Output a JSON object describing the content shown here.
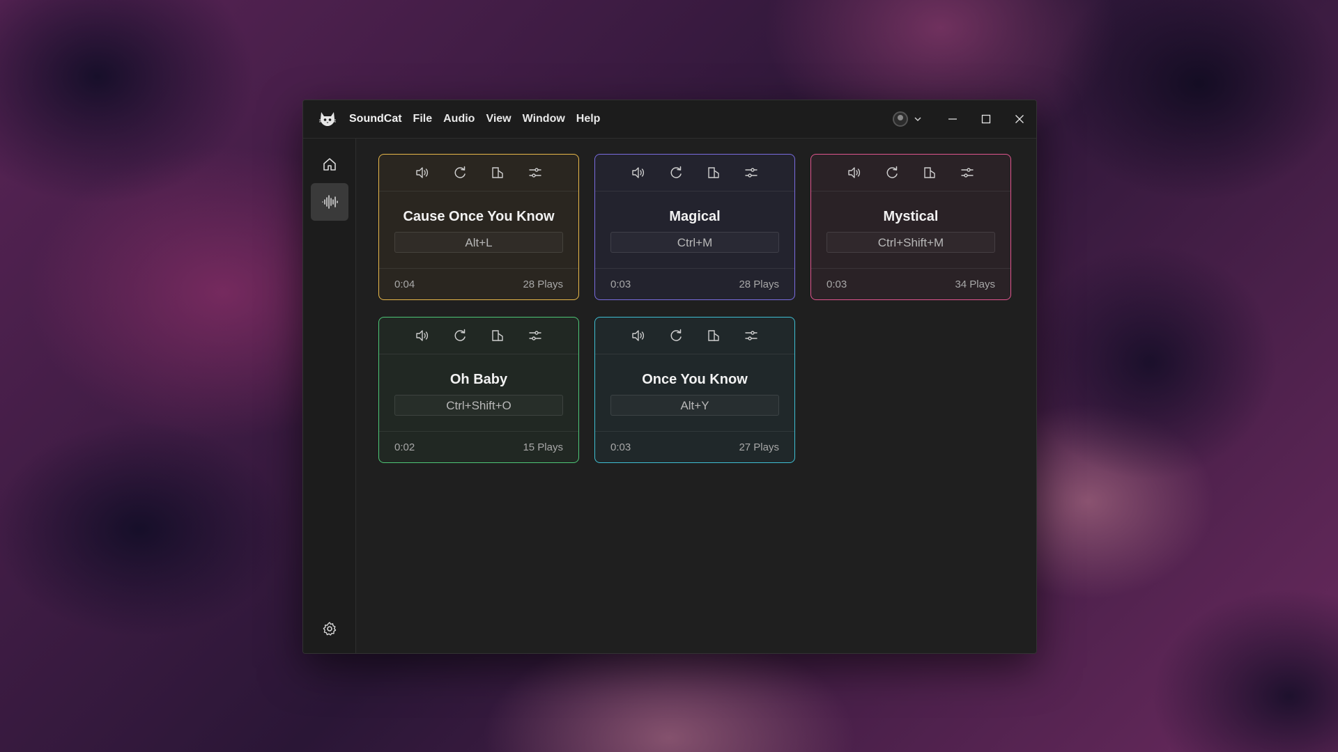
{
  "app": {
    "title": "SoundCat",
    "menu": [
      "File",
      "Audio",
      "View",
      "Window",
      "Help"
    ]
  },
  "sidebar": {
    "items": [
      {
        "icon": "home-icon",
        "active": false
      },
      {
        "icon": "waveform-icon",
        "active": true
      }
    ],
    "bottom_icon": "gear-icon"
  },
  "cards": [
    {
      "title": "Cause Once You Know",
      "shortcut": "Alt+L",
      "duration": "0:04",
      "plays": "28 Plays",
      "color": "#e8b84a",
      "bg": "#2a2620"
    },
    {
      "title": "Magical",
      "shortcut": "Ctrl+M",
      "duration": "0:03",
      "plays": "28 Plays",
      "color": "#7a6de0",
      "bg": "#23232e"
    },
    {
      "title": "Mystical",
      "shortcut": "Ctrl+Shift+M",
      "duration": "0:03",
      "plays": "34 Plays",
      "color": "#e0568e",
      "bg": "#2a2226"
    },
    {
      "title": "Oh Baby",
      "shortcut": "Ctrl+Shift+O",
      "duration": "0:02",
      "plays": "15 Plays",
      "color": "#4ec777",
      "bg": "#212823"
    },
    {
      "title": "Once You Know",
      "shortcut": "Alt+Y",
      "duration": "0:03",
      "plays": "27 Plays",
      "color": "#3fc0d4",
      "bg": "#20282a"
    }
  ],
  "card_tools": [
    "volume-icon",
    "loop-icon",
    "copy-icon",
    "settings-sliders-icon"
  ]
}
